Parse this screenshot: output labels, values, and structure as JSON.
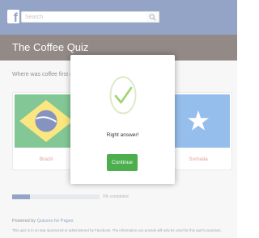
{
  "fb_header": {
    "logo_letter": "f",
    "search_placeholder": "Search",
    "icons": [
      "facebook-logo-icon",
      "search-icon"
    ]
  },
  "quiz": {
    "title": "The Coffee Quiz",
    "question": "Where was coffee first discovered?",
    "answers": [
      {
        "label": "Brazil",
        "flag_icon": "brazil-flag"
      },
      {
        "label": "Somalia",
        "flag_icon": "somalia-flag"
      }
    ],
    "progress": {
      "percent": 0,
      "text": "0% completed"
    },
    "footer": {
      "powered_prefix": "Powered by",
      "powered_link": "Quizzes for Pages",
      "disclaimer": "This quiz is in no way sponsored or administered by Facebook. The information you provide will only be used for this quiz's purposes."
    }
  },
  "modal": {
    "icon": "check-circle-icon",
    "message": "Right answer!",
    "button_label": "Continue"
  },
  "colors": {
    "facebook_blue": "#3b5998",
    "title_bar": "#3b2b25",
    "answer_label": "#c4543a",
    "check_green": "#9fd46f",
    "button_green": "#4cae4c"
  }
}
